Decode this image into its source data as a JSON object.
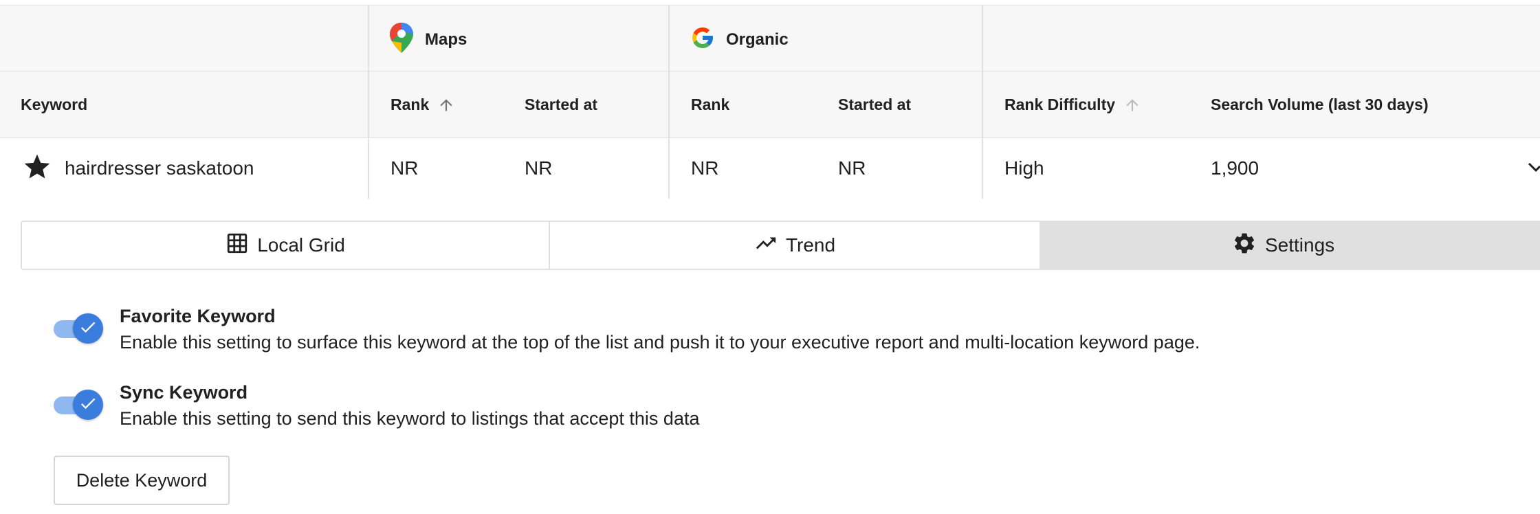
{
  "groups": {
    "maps": {
      "label": "Maps",
      "icon": "google-maps-pin-icon"
    },
    "organic": {
      "label": "Organic",
      "icon": "google-g-logo-icon"
    }
  },
  "columns": {
    "keyword": "Keyword",
    "maps_rank": "Rank",
    "maps_started": "Started at",
    "organic_rank": "Rank",
    "organic_started": "Started at",
    "rank_difficulty": "Rank Difficulty",
    "search_volume": "Search Volume (last 30 days)"
  },
  "row": {
    "keyword": "hairdresser saskatoon",
    "favorite": true,
    "maps_rank": "NR",
    "maps_started": "NR",
    "organic_rank": "NR",
    "organic_started": "NR",
    "rank_difficulty": "High",
    "search_volume": "1,900"
  },
  "tabs": [
    {
      "label": "Local Grid",
      "icon": "grid-icon",
      "active": false
    },
    {
      "label": "Trend",
      "icon": "trending-up-icon",
      "active": false
    },
    {
      "label": "Settings",
      "icon": "gear-icon",
      "active": true
    }
  ],
  "settings": [
    {
      "title": "Favorite Keyword",
      "description": "Enable this setting to surface this keyword at the top of the list and push it to your executive report and multi-location keyword page.",
      "enabled": true
    },
    {
      "title": "Sync Keyword",
      "description": "Enable this setting to send this keyword to listings that accept this data",
      "enabled": true
    }
  ],
  "delete_button": "Delete Keyword",
  "colors": {
    "header_bg": "#f7f7f7",
    "active_tab_bg": "#e0e0e0",
    "toggle_knob": "#3b7ddd",
    "toggle_track": "#90b8f0"
  }
}
